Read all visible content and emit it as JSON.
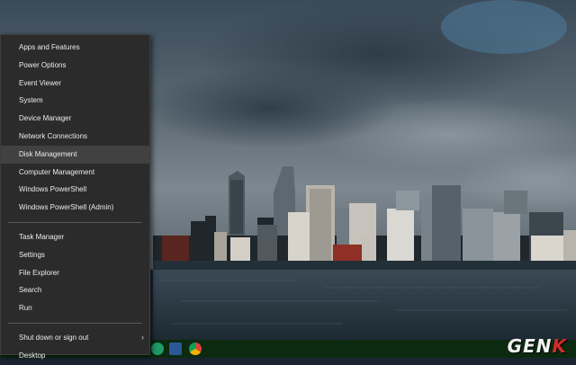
{
  "menu": {
    "group1": [
      {
        "label": "Apps and Features"
      },
      {
        "label": "Power Options"
      },
      {
        "label": "Event Viewer"
      },
      {
        "label": "System"
      },
      {
        "label": "Device Manager"
      },
      {
        "label": "Network Connections"
      },
      {
        "label": "Disk Management",
        "highlighted": true
      },
      {
        "label": "Computer Management"
      },
      {
        "label": "Windows PowerShell"
      },
      {
        "label": "Windows PowerShell (Admin)"
      }
    ],
    "group2": [
      {
        "label": "Task Manager"
      },
      {
        "label": "Settings"
      },
      {
        "label": "File Explorer"
      },
      {
        "label": "Search"
      },
      {
        "label": "Run"
      }
    ],
    "group3": [
      {
        "label": "Shut down or sign out",
        "submenu_icon": "chevron-right-icon"
      },
      {
        "label": "Desktop"
      }
    ]
  },
  "taskbar": {
    "icons": [
      "edge-icon",
      "word-icon",
      "chrome-icon"
    ]
  },
  "watermark": {
    "text_main": "GEN",
    "text_accent": "K"
  },
  "colors": {
    "menu_bg": "#2b2b2b",
    "menu_highlight": "#414141",
    "taskbar_bg": "#0c2a0f",
    "watermark_accent": "#d42a2a"
  }
}
